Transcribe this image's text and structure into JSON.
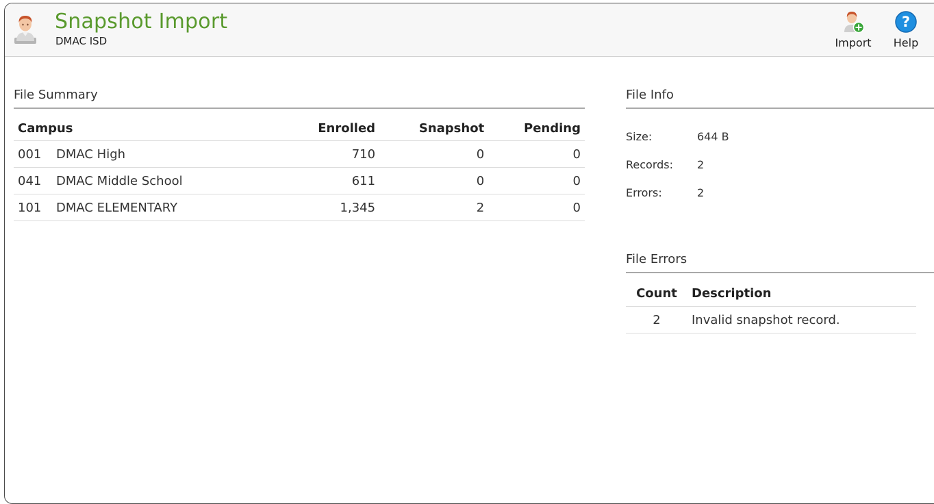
{
  "header": {
    "title": "Snapshot Import",
    "subtitle": "DMAC ISD",
    "avatar_icon": "user-avatar-icon",
    "title_color": "#5a9a2e"
  },
  "toolbar": {
    "import_label": "Import",
    "import_icon": "user-add-icon",
    "help_label": "Help",
    "help_icon": "help-icon",
    "help_color": "#1f8fe0",
    "add_badge_color": "#3aa63a"
  },
  "file_summary": {
    "title": "File Summary",
    "columns": [
      "Campus",
      "Enrolled",
      "Snapshot",
      "Pending"
    ],
    "rows": [
      {
        "code": "001",
        "name": "DMAC High",
        "enrolled": "710",
        "snapshot": "0",
        "pending": "0"
      },
      {
        "code": "041",
        "name": "DMAC Middle School",
        "enrolled": "611",
        "snapshot": "0",
        "pending": "0"
      },
      {
        "code": "101",
        "name": "DMAC ELEMENTARY",
        "enrolled": "1,345",
        "snapshot": "2",
        "pending": "0"
      }
    ]
  },
  "file_info": {
    "title": "File Info",
    "size_label": "Size:",
    "size_value": "644 B",
    "records_label": "Records:",
    "records_value": "2",
    "errors_label": "Errors:",
    "errors_value": "2"
  },
  "file_errors": {
    "title": "File Errors",
    "columns": [
      "Count",
      "Description"
    ],
    "rows": [
      {
        "count": "2",
        "description": "Invalid snapshot record."
      }
    ]
  }
}
